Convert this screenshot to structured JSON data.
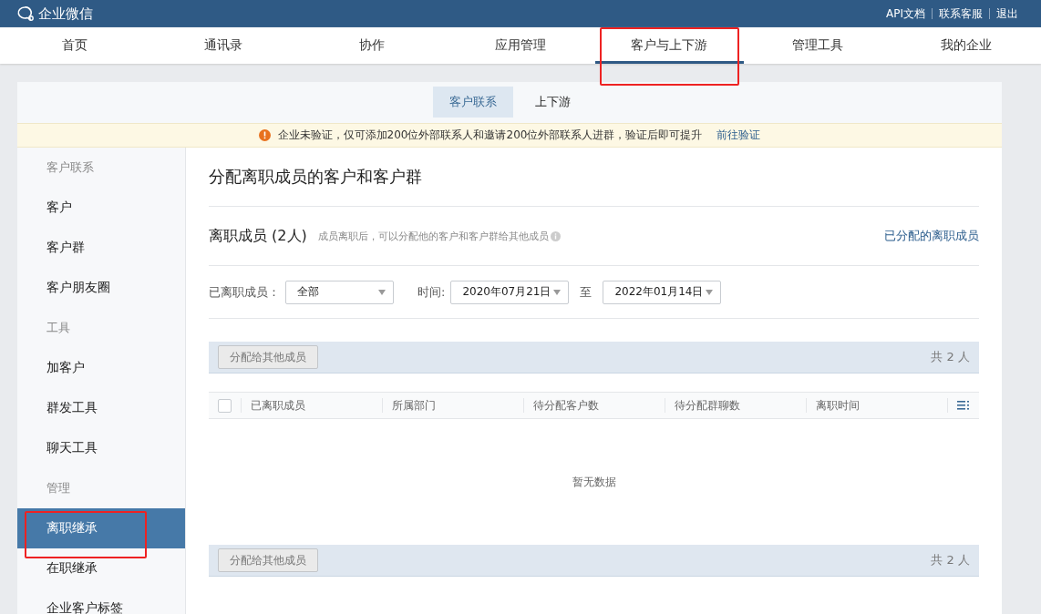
{
  "header": {
    "logo": "企业微信",
    "links": [
      "API文档",
      "联系客服",
      "退出"
    ]
  },
  "nav": [
    {
      "label": "首页",
      "selected": false,
      "highlighted": false
    },
    {
      "label": "通讯录",
      "selected": false,
      "highlighted": false
    },
    {
      "label": "协作",
      "selected": false,
      "highlighted": false
    },
    {
      "label": "应用管理",
      "selected": false,
      "highlighted": false
    },
    {
      "label": "客户与上下游",
      "selected": true,
      "highlighted": true
    },
    {
      "label": "管理工具",
      "selected": false,
      "highlighted": false
    },
    {
      "label": "我的企业",
      "selected": false,
      "highlighted": false
    }
  ],
  "subtabs": [
    {
      "label": "客户联系",
      "selected": true
    },
    {
      "label": "上下游",
      "selected": false
    }
  ],
  "notice": {
    "text": "企业未验证，仅可添加200位外部联系人和邀请200位外部联系人进群，验证后即可提升",
    "link": "前往验证"
  },
  "sidebar": [
    {
      "heading": "客户联系",
      "items": [
        {
          "label": "客户",
          "selected": false,
          "highlighted": false
        },
        {
          "label": "客户群",
          "selected": false,
          "highlighted": false
        },
        {
          "label": "客户朋友圈",
          "selected": false,
          "highlighted": false
        }
      ]
    },
    {
      "heading": "工具",
      "items": [
        {
          "label": "加客户",
          "selected": false,
          "highlighted": false
        },
        {
          "label": "群发工具",
          "selected": false,
          "highlighted": false
        },
        {
          "label": "聊天工具",
          "selected": false,
          "highlighted": false
        }
      ]
    },
    {
      "heading": "管理",
      "items": [
        {
          "label": "离职继承",
          "selected": true,
          "highlighted": true
        },
        {
          "label": "在职继承",
          "selected": false,
          "highlighted": false
        },
        {
          "label": "企业客户标签",
          "selected": false,
          "highlighted": false
        }
      ]
    }
  ],
  "page_title": "分配离职成员的客户和客户群",
  "section": {
    "title": "离职成员 (2人)",
    "hint": "成员离职后，可以分配他的客户和客户群给其他成员",
    "link": "已分配的离职成员"
  },
  "filters": {
    "member_label": "已离职成员：",
    "member_value": "全部",
    "time_label": "时间:",
    "from": "2020年07月21日",
    "to_label": "至",
    "to": "2022年01月14日"
  },
  "toolbar_top": {
    "button": "分配给其他成员",
    "count": "共 2 人"
  },
  "table": {
    "checked": false,
    "columns": [
      "已离职成员",
      "所属部门",
      "待分配客户数",
      "待分配群聊数",
      "离职时间"
    ],
    "empty": "暂无数据"
  },
  "toolbar_bottom": {
    "button": "分配给其他成员",
    "count": "共 2 人"
  }
}
